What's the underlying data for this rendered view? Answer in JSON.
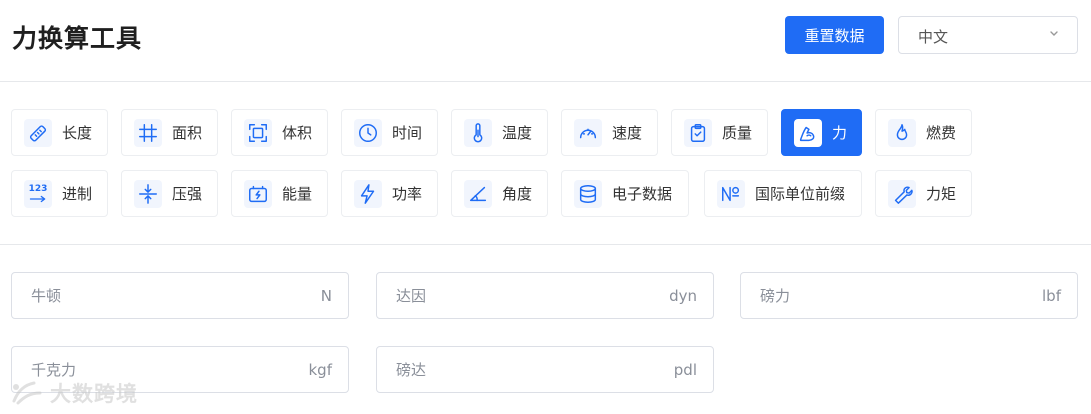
{
  "header": {
    "title": "力换算工具",
    "reset_label": "重置数据",
    "language": "中文"
  },
  "categories": [
    {
      "label": "长度",
      "icon": "ruler-icon"
    },
    {
      "label": "面积",
      "icon": "hashtag-icon"
    },
    {
      "label": "体积",
      "icon": "cube-frame-icon"
    },
    {
      "label": "时间",
      "icon": "clock-icon"
    },
    {
      "label": "温度",
      "icon": "thermometer-icon"
    },
    {
      "label": "速度",
      "icon": "speedometer-icon"
    },
    {
      "label": "质量",
      "icon": "clipboard-check-icon"
    },
    {
      "label": "力",
      "icon": "arm-muscle-icon",
      "active": true
    },
    {
      "label": "燃费",
      "icon": "flame-icon"
    },
    {
      "label": "进制",
      "icon": "number-base-icon"
    },
    {
      "label": "压强",
      "icon": "compress-icon"
    },
    {
      "label": "能量",
      "icon": "battery-charge-icon"
    },
    {
      "label": "功率",
      "icon": "lightning-icon"
    },
    {
      "label": "角度",
      "icon": "angle-icon"
    },
    {
      "label": "电子数据",
      "icon": "database-icon"
    },
    {
      "label": "国际单位前缀",
      "icon": "numero-icon"
    },
    {
      "label": "力矩",
      "icon": "wrench-icon"
    }
  ],
  "number_base_icon_text": "123",
  "fields": [
    {
      "placeholder": "牛顿",
      "unit": "N"
    },
    {
      "placeholder": "达因",
      "unit": "dyn"
    },
    {
      "placeholder": "磅力",
      "unit": "lbf"
    },
    {
      "placeholder": "千克力",
      "unit": "kgf"
    },
    {
      "placeholder": "磅达",
      "unit": "pdl"
    }
  ],
  "watermark": "大数跨境",
  "colors": {
    "accent": "#1f6cf5",
    "border": "#dcdfe6"
  }
}
